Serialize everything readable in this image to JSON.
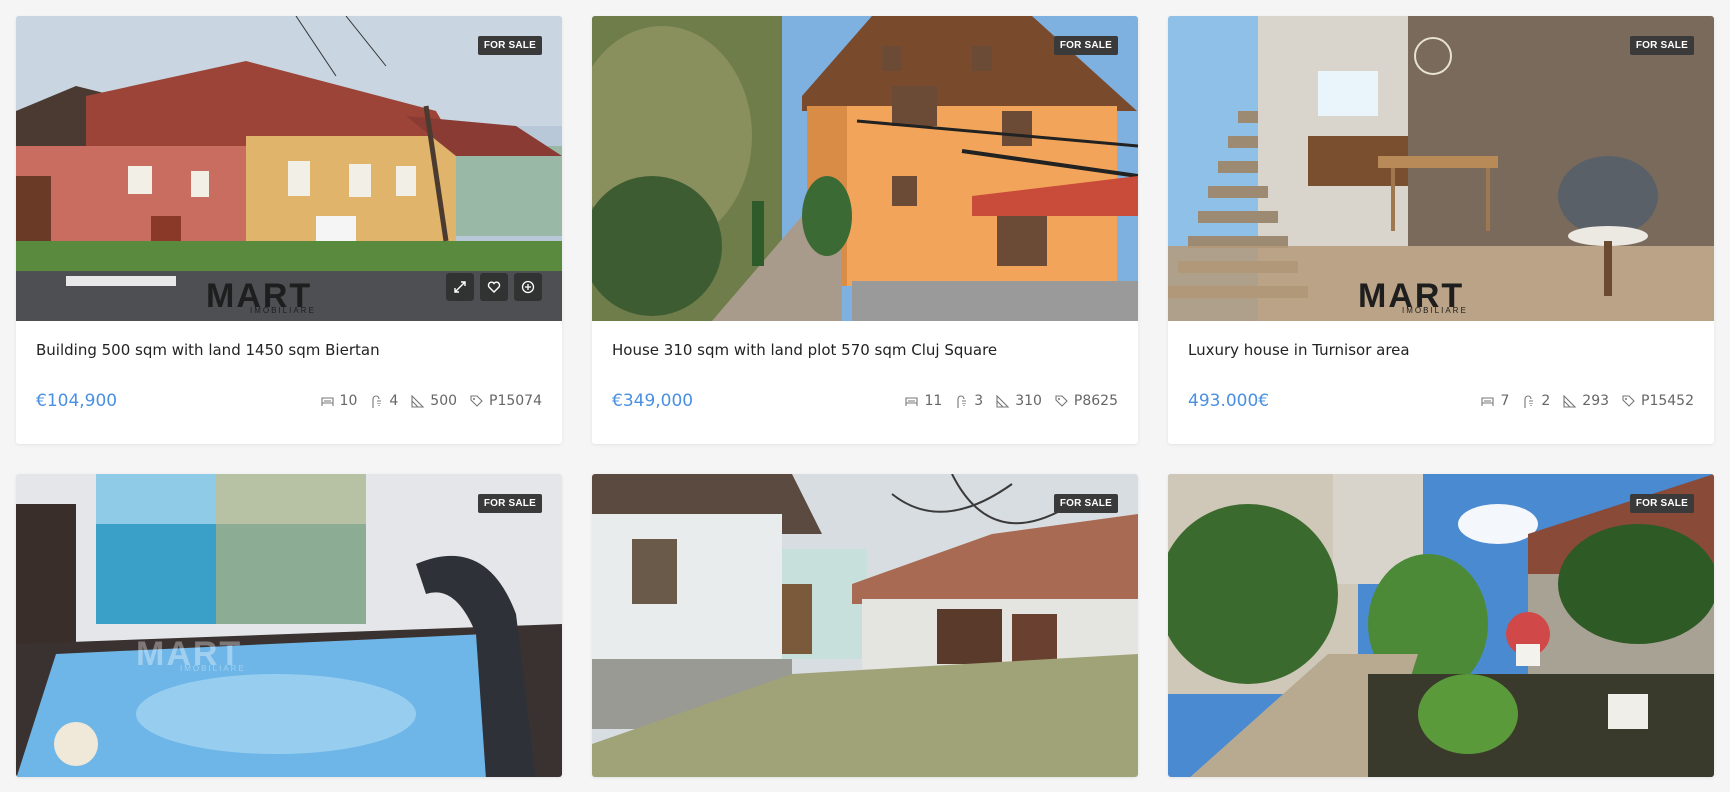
{
  "listings": [
    {
      "badge": "FOR SALE",
      "title": "Building 500 sqm with land 1450 sqm Biertan",
      "price": "€104,900",
      "rooms": "10",
      "baths": "4",
      "area": "500",
      "ref": "P15074",
      "logo_text": "MART",
      "logo_sub": "IMOBILIARE"
    },
    {
      "badge": "FOR SALE",
      "title": "House 310 sqm with land plot 570 sqm Cluj Square",
      "price": "€349,000",
      "rooms": "11",
      "baths": "3",
      "area": "310",
      "ref": "P8625"
    },
    {
      "badge": "FOR SALE",
      "title": "Luxury house in Turnisor area",
      "price": "493.000€",
      "rooms": "7",
      "baths": "2",
      "area": "293",
      "ref": "P15452",
      "logo_text": "MART",
      "logo_sub": "IMOBILIARE"
    },
    {
      "badge": "FOR SALE",
      "logo_text": "MART",
      "logo_sub": "IMOBILIARE"
    },
    {
      "badge": "FOR SALE"
    },
    {
      "badge": "FOR SALE"
    }
  ],
  "icons": {
    "rooms": "bed-icon",
    "baths": "shower-icon",
    "area": "area-icon",
    "ref": "tag-icon",
    "expand": "expand-icon",
    "favorite": "heart-icon",
    "compare": "plus-circle-icon"
  },
  "colors": {
    "price": "#4a90e2",
    "badge": "#3a3a3a",
    "background": "#f5f5f5"
  }
}
